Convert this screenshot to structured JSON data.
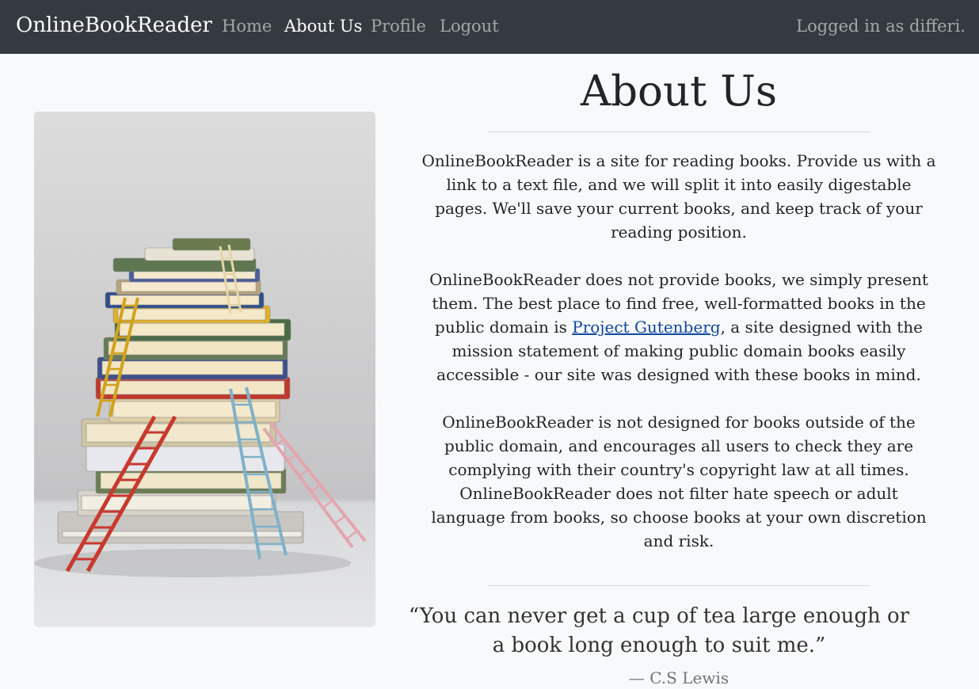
{
  "navbar": {
    "brand": "OnlineBookReader",
    "links": [
      {
        "label": "Home"
      },
      {
        "label": "About Us"
      },
      {
        "label": "Profile"
      },
      {
        "label": "Logout"
      }
    ],
    "status": "Logged in as differi."
  },
  "main": {
    "title": "About Us",
    "paragraph1": "OnlineBookReader is a site for reading books. Provide us with a link to a text file, and we will split it into easily digestable pages. We'll save your current books, and keep track of your reading position.",
    "paragraph2_before": "OnlineBookReader does not provide books, we simply present them. The best place to find free, well-formatted books in the public domain is ",
    "paragraph2_link": "Project Gutenberg",
    "paragraph2_after": ", a site designed with the mission statement of making public domain books easily accessible - our site was designed with these books in mind.",
    "paragraph3": "OnlineBookReader is not designed for books outside of the public domain, and encourages all users to check they are complying with their country's copyright law at all times. OnlineBookReader does not filter hate speech or adult language from books, so choose books at your own discretion and risk.",
    "quote": "“You can never get a cup of tea large enough or a book long enough to suit me.”",
    "quote_author": "— C.S Lewis"
  },
  "colors": {
    "navbar_bg": "#343a40",
    "page_bg": "#f8f9fa",
    "link": "#0d47a1"
  }
}
